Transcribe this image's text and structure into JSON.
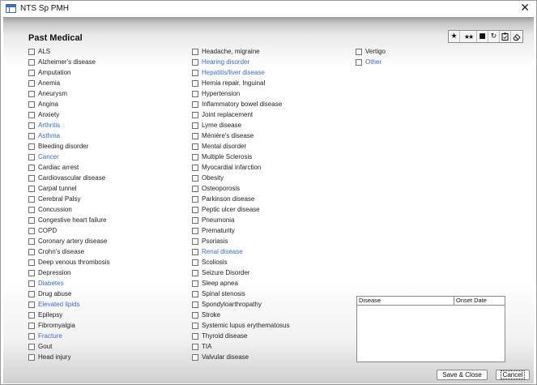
{
  "window": {
    "title": "NTS Sp PMH"
  },
  "section": {
    "title": "Past Medical"
  },
  "toolbar": {
    "buttons": [
      {
        "name": "star-icon",
        "glyph": "★"
      },
      {
        "name": "stars-icon",
        "glyph": "★★"
      },
      {
        "name": "save-icon",
        "glyph": "■"
      },
      {
        "name": "refresh-icon",
        "glyph": "↻"
      },
      {
        "name": "clipboard-icon",
        "glyph": "📋"
      },
      {
        "name": "eraser-icon",
        "glyph": "⌫"
      }
    ]
  },
  "conditions": {
    "column1": [
      {
        "label": "ALS",
        "highlighted": false,
        "checked": false
      },
      {
        "label": "Alzheimer's disease",
        "highlighted": false,
        "checked": false
      },
      {
        "label": "Amputation",
        "highlighted": false,
        "checked": false
      },
      {
        "label": "Anemia",
        "highlighted": false,
        "checked": false
      },
      {
        "label": "Aneurysm",
        "highlighted": false,
        "checked": false
      },
      {
        "label": "Angina",
        "highlighted": false,
        "checked": false
      },
      {
        "label": "Anxiety",
        "highlighted": false,
        "checked": false
      },
      {
        "label": "Arthritis",
        "highlighted": true,
        "checked": false
      },
      {
        "label": "Asthma",
        "highlighted": true,
        "checked": false
      },
      {
        "label": "Bleeding disorder",
        "highlighted": false,
        "checked": false
      },
      {
        "label": "Cancer",
        "highlighted": true,
        "checked": false
      },
      {
        "label": "Cardiac arrest",
        "highlighted": false,
        "checked": false
      },
      {
        "label": "Cardiovascular disease",
        "highlighted": false,
        "checked": false
      },
      {
        "label": "Carpal tunnel",
        "highlighted": false,
        "checked": false
      },
      {
        "label": "Cerebral Palsy",
        "highlighted": false,
        "checked": false
      },
      {
        "label": "Concussion",
        "highlighted": false,
        "checked": false
      },
      {
        "label": "Congestive heart failure",
        "highlighted": false,
        "checked": false
      },
      {
        "label": "COPD",
        "highlighted": false,
        "checked": false
      },
      {
        "label": "Coronary artery disease",
        "highlighted": false,
        "checked": false
      },
      {
        "label": "Crohn's disease",
        "highlighted": false,
        "checked": false
      },
      {
        "label": "Deep venous thrombosis",
        "highlighted": false,
        "checked": false
      },
      {
        "label": "Depression",
        "highlighted": false,
        "checked": false
      },
      {
        "label": "Diabetes",
        "highlighted": true,
        "checked": false
      },
      {
        "label": "Drug abuse",
        "highlighted": false,
        "checked": false
      },
      {
        "label": "Elevated lipids",
        "highlighted": true,
        "checked": false
      },
      {
        "label": "Epilepsy",
        "highlighted": false,
        "checked": false
      },
      {
        "label": "Fibromyalgia",
        "highlighted": false,
        "checked": false
      },
      {
        "label": "Fracture",
        "highlighted": true,
        "checked": false
      },
      {
        "label": "Gout",
        "highlighted": false,
        "checked": false
      },
      {
        "label": "Head injury",
        "highlighted": false,
        "checked": false
      }
    ],
    "column2": [
      {
        "label": "Headache, migraine",
        "highlighted": false,
        "checked": false
      },
      {
        "label": "Hearing disorder",
        "highlighted": true,
        "checked": false
      },
      {
        "label": "Hepatitis/liver disease",
        "highlighted": true,
        "checked": false
      },
      {
        "label": "Hernia repair, Inguinal",
        "highlighted": false,
        "checked": false
      },
      {
        "label": "Hypertension",
        "highlighted": false,
        "checked": false
      },
      {
        "label": "Inflammatory bowel disease",
        "highlighted": false,
        "checked": false
      },
      {
        "label": "Joint replacement",
        "highlighted": false,
        "checked": false
      },
      {
        "label": "Lyme disease",
        "highlighted": false,
        "checked": false
      },
      {
        "label": "Ménière's disease",
        "highlighted": false,
        "checked": false
      },
      {
        "label": "Mental disorder",
        "highlighted": false,
        "checked": false
      },
      {
        "label": "Multiple Sclerosis",
        "highlighted": false,
        "checked": false
      },
      {
        "label": "Myocardial infarction",
        "highlighted": false,
        "checked": false
      },
      {
        "label": "Obesity",
        "highlighted": false,
        "checked": false
      },
      {
        "label": "Osteoporosis",
        "highlighted": false,
        "checked": false
      },
      {
        "label": "Parkinson disease",
        "highlighted": false,
        "checked": false
      },
      {
        "label": "Peptic ulcer disease",
        "highlighted": false,
        "checked": false
      },
      {
        "label": "Pneumonia",
        "highlighted": false,
        "checked": false
      },
      {
        "label": "Prematurity",
        "highlighted": false,
        "checked": false
      },
      {
        "label": "Psoriasis",
        "highlighted": false,
        "checked": false
      },
      {
        "label": "Renal disease",
        "highlighted": true,
        "checked": false
      },
      {
        "label": "Scoliosis",
        "highlighted": false,
        "checked": false
      },
      {
        "label": "Seizure Disorder",
        "highlighted": false,
        "checked": false
      },
      {
        "label": "Sleep apnea",
        "highlighted": false,
        "checked": false
      },
      {
        "label": "Spinal stenosis",
        "highlighted": false,
        "checked": false
      },
      {
        "label": "Spondyloarthropathy",
        "highlighted": false,
        "checked": false
      },
      {
        "label": "Stroke",
        "highlighted": false,
        "checked": false
      },
      {
        "label": "Systemic lupus erythematosus",
        "highlighted": false,
        "checked": false
      },
      {
        "label": "Thyroid disease",
        "highlighted": false,
        "checked": false
      },
      {
        "label": "TIA",
        "highlighted": false,
        "checked": false
      },
      {
        "label": "Valvular disease",
        "highlighted": false,
        "checked": false
      }
    ],
    "column3": [
      {
        "label": "Vertigo",
        "highlighted": false,
        "checked": false
      },
      {
        "label": "Other",
        "highlighted": true,
        "checked": false
      }
    ]
  },
  "grid": {
    "columns": [
      "Disease",
      "Onset Date"
    ],
    "rows": []
  },
  "buttons": {
    "save_close": "Save & Close",
    "cancel": "Cancel"
  },
  "colors": {
    "highlight": "#3a6ad6",
    "text": "#222222"
  }
}
